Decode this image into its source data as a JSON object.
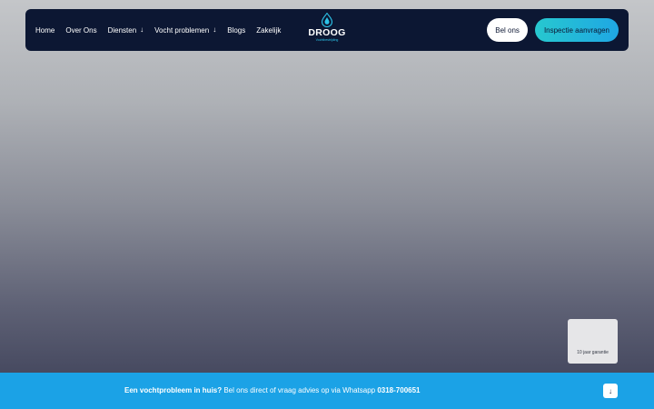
{
  "nav": {
    "items": [
      {
        "label": "Home",
        "dropdown": false
      },
      {
        "label": "Over Ons",
        "dropdown": false
      },
      {
        "label": "Diensten",
        "dropdown": true
      },
      {
        "label": "Vocht problemen",
        "dropdown": true
      },
      {
        "label": "Blogs",
        "dropdown": false
      },
      {
        "label": "Zakelijk",
        "dropdown": false
      }
    ],
    "dropdown_icon": "arrow-down-icon"
  },
  "logo": {
    "word": "DROOG",
    "subtitle": "Vochtbestrijding",
    "icon": "water-drop-icon"
  },
  "cta": {
    "call_label": "Bel ons",
    "inspect_label": "Inspectie aanvragen"
  },
  "guarantee": {
    "label": "10 jaar garantie"
  },
  "bottom_bar": {
    "lead": "Een vochtprobleem in huis?",
    "text": " Bel ons direct of vraag advies op via Whatsapp ",
    "phone": "0318-700651",
    "scroll_icon": "arrow-down-icon"
  },
  "colors": {
    "navy": "#0c1733",
    "accent_blue": "#1ba2e6",
    "accent_teal": "#27c8cf"
  }
}
